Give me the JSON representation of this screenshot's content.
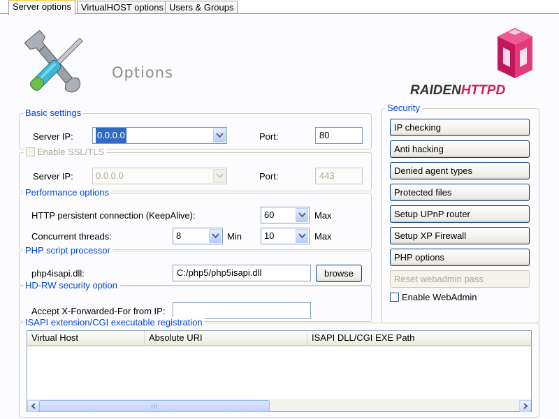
{
  "tabs": [
    {
      "label": "Server options",
      "active": true
    },
    {
      "label": "VirtualHOST options",
      "active": false
    },
    {
      "label": "Users & Groups",
      "active": false
    }
  ],
  "header": {
    "title": "Options",
    "brand_part1": "RAIDEN",
    "brand_part2": "HTTPD",
    "tools_icon": "tools-icon",
    "logo_icon": "raiden-cube-logo"
  },
  "basic_settings": {
    "legend": "Basic settings",
    "server_ip_label": "Server IP:",
    "server_ip_value": "0.0.0.0",
    "port_label": "Port:",
    "port_value": "80"
  },
  "ssl": {
    "legend": "Enable SSL/TLS",
    "checked": false,
    "server_ip_label": "Server IP:",
    "server_ip_value": "0.0.0.0",
    "port_label": "Port:",
    "port_value": "443"
  },
  "performance": {
    "legend": "Performance options",
    "keepalive_label": "HTTP persistent connection (KeepAlive):",
    "keepalive_value": "60",
    "keepalive_suffix": "Max",
    "threads_label": "Concurrent threads:",
    "threads_min_value": "8",
    "threads_min_suffix": "Min",
    "threads_max_value": "10",
    "threads_max_suffix": "Max"
  },
  "php": {
    "legend": "PHP script processor",
    "label": "php4isapi.dll:",
    "path_value": "C:/php5/php5isapi.dll",
    "browse_label": "browse"
  },
  "hdrw": {
    "legend": "HD-RW security option",
    "label": "Accept X-Forwarded-For from IP:",
    "value": ""
  },
  "isapi": {
    "legend": "ISAPI extension/CGI executable registration",
    "columns": [
      "Virtual Host",
      "Absolute URI",
      "ISAPI DLL/CGI EXE Path"
    ],
    "rows": []
  },
  "security": {
    "legend": "Security",
    "buttons": [
      {
        "label": "IP checking",
        "enabled": true
      },
      {
        "label": "Anti hacking",
        "enabled": true
      },
      {
        "label": "Denied agent types",
        "enabled": true
      },
      {
        "label": "Protected files",
        "enabled": true
      },
      {
        "label": "Setup UPnP router",
        "enabled": true
      },
      {
        "label": "Setup XP Firewall",
        "enabled": true
      },
      {
        "label": "PHP options",
        "enabled": true
      },
      {
        "label": "Reset webadmin pass",
        "enabled": false
      }
    ],
    "enable_webadmin_label": "Enable WebAdmin",
    "enable_webadmin_checked": false
  },
  "colors": {
    "group_legend": "#0046d5",
    "brand_accent": "#d81a5a",
    "tab_highlight": "#ffc83c"
  }
}
